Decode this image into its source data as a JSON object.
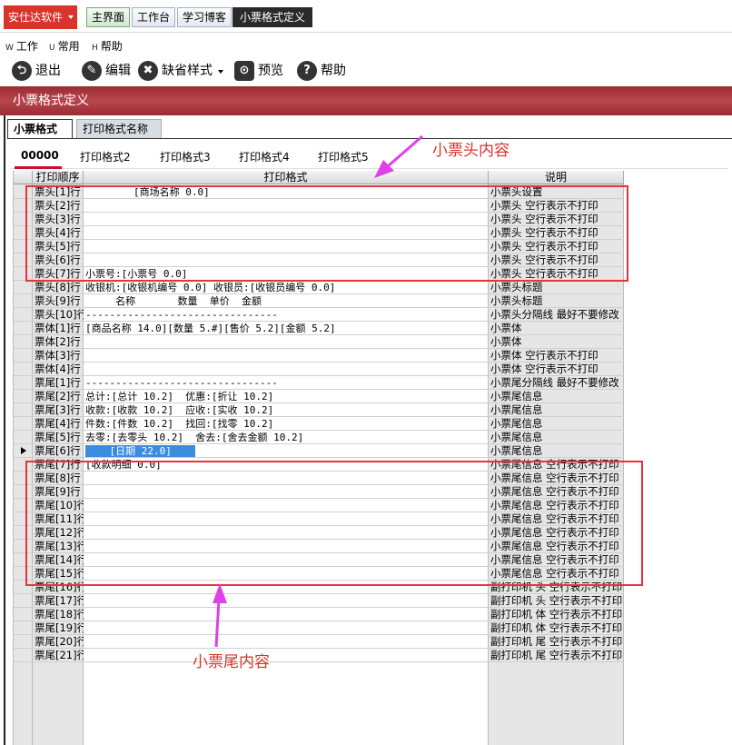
{
  "app": {
    "brand": "安仕达软件",
    "tabs": [
      "主界面",
      "工作台",
      "学习博客",
      "小票格式定义"
    ]
  },
  "menu": [
    {
      "key": "W",
      "label": "工作"
    },
    {
      "key": "U",
      "label": "常用"
    },
    {
      "key": "H",
      "label": "帮助"
    }
  ],
  "toolbar": {
    "exit": "退出",
    "edit": "编辑",
    "default_style": "缺省样式",
    "preview": "预览",
    "help": "帮助"
  },
  "page_title": "小票格式定义",
  "section_tabs": [
    "小票格式",
    "打印格式名称"
  ],
  "format_tabs": [
    "00000",
    "打印格式2",
    "打印格式3",
    "打印格式4",
    "打印格式5"
  ],
  "grid": {
    "columns": [
      "打印顺序",
      "打印格式",
      "说明"
    ],
    "rows": [
      [
        "票头[1]行",
        "        [商场名称 0.0]",
        "小票头设置"
      ],
      [
        "票头[2]行",
        "",
        "小票头 空行表示不打印"
      ],
      [
        "票头[3]行",
        "",
        "小票头 空行表示不打印"
      ],
      [
        "票头[4]行",
        "",
        "小票头 空行表示不打印"
      ],
      [
        "票头[5]行",
        "",
        "小票头 空行表示不打印"
      ],
      [
        "票头[6]行",
        "",
        "小票头 空行表示不打印"
      ],
      [
        "票头[7]行",
        "小票号:[小票号 0.0]",
        "小票头 空行表示不打印"
      ],
      [
        "票头[8]行",
        "收银机:[收银机编号 0.0] 收银员:[收银员编号 0.0]",
        "小票头标题"
      ],
      [
        "票头[9]行",
        "     名称       数量  单价  金额",
        "小票头标题"
      ],
      [
        "票头[10]行",
        "--------------------------------",
        "小票头分隔线 最好不要修改"
      ],
      [
        "票体[1]行",
        "[商品名称 14.0][数量 5.#][售价 5.2][金额 5.2]",
        "小票体"
      ],
      [
        "票体[2]行",
        "",
        "小票体"
      ],
      [
        "票体[3]行",
        "",
        "小票体 空行表示不打印"
      ],
      [
        "票体[4]行",
        "",
        "小票体 空行表示不打印"
      ],
      [
        "票尾[1]行",
        "--------------------------------",
        "小票尾分隔线 最好不要修改"
      ],
      [
        "票尾[2]行",
        "总计:[总计 10.2]  优惠:[折让 10.2]",
        "小票尾信息"
      ],
      [
        "票尾[3]行",
        "收款:[收款 10.2]  应收:[实收 10.2]",
        "小票尾信息"
      ],
      [
        "票尾[4]行",
        "件数:[件数 10.2]  找回:[找零 10.2]",
        "小票尾信息"
      ],
      [
        "票尾[5]行",
        "去零:[去零头 10.2]  舍去:[舍去金额 10.2]",
        "小票尾信息"
      ],
      [
        "票尾[6]行",
        "    [日期 22.0]    ",
        "小票尾信息"
      ],
      [
        "票尾[7]行",
        "[收款明细 0.0]",
        "小票尾信息 空行表示不打印"
      ],
      [
        "票尾[8]行",
        "",
        "小票尾信息 空行表示不打印"
      ],
      [
        "票尾[9]行",
        "",
        "小票尾信息 空行表示不打印"
      ],
      [
        "票尾[10]行",
        "",
        "小票尾信息 空行表示不打印"
      ],
      [
        "票尾[11]行",
        "",
        "小票尾信息 空行表示不打印"
      ],
      [
        "票尾[12]行",
        "",
        "小票尾信息 空行表示不打印"
      ],
      [
        "票尾[13]行",
        "",
        "小票尾信息 空行表示不打印"
      ],
      [
        "票尾[14]行",
        "",
        "小票尾信息 空行表示不打印"
      ],
      [
        "票尾[15]行",
        "",
        "小票尾信息 空行表示不打印"
      ],
      [
        "票尾[16]行",
        "",
        "副打印机 头 空行表示不打印"
      ],
      [
        "票尾[17]行",
        "",
        "副打印机 头 空行表示不打印"
      ],
      [
        "票尾[18]行",
        "",
        "副打印机 体 空行表示不打印"
      ],
      [
        "票尾[19]行",
        "",
        "副打印机 体 空行表示不打印"
      ],
      [
        "票尾[20]行",
        "",
        "副打印机 尾 空行表示不打印"
      ],
      [
        "票尾[21]行",
        "",
        "副打印机 尾 空行表示不打印"
      ]
    ],
    "selected_row": 19
  },
  "annotations": {
    "header": "小票头内容",
    "footer": "小票尾内容"
  },
  "colors": {
    "brand": "#d9342b",
    "title_bar": "#9a2b31",
    "annotation": "#e8323c",
    "selection": "#3c8ce0"
  }
}
